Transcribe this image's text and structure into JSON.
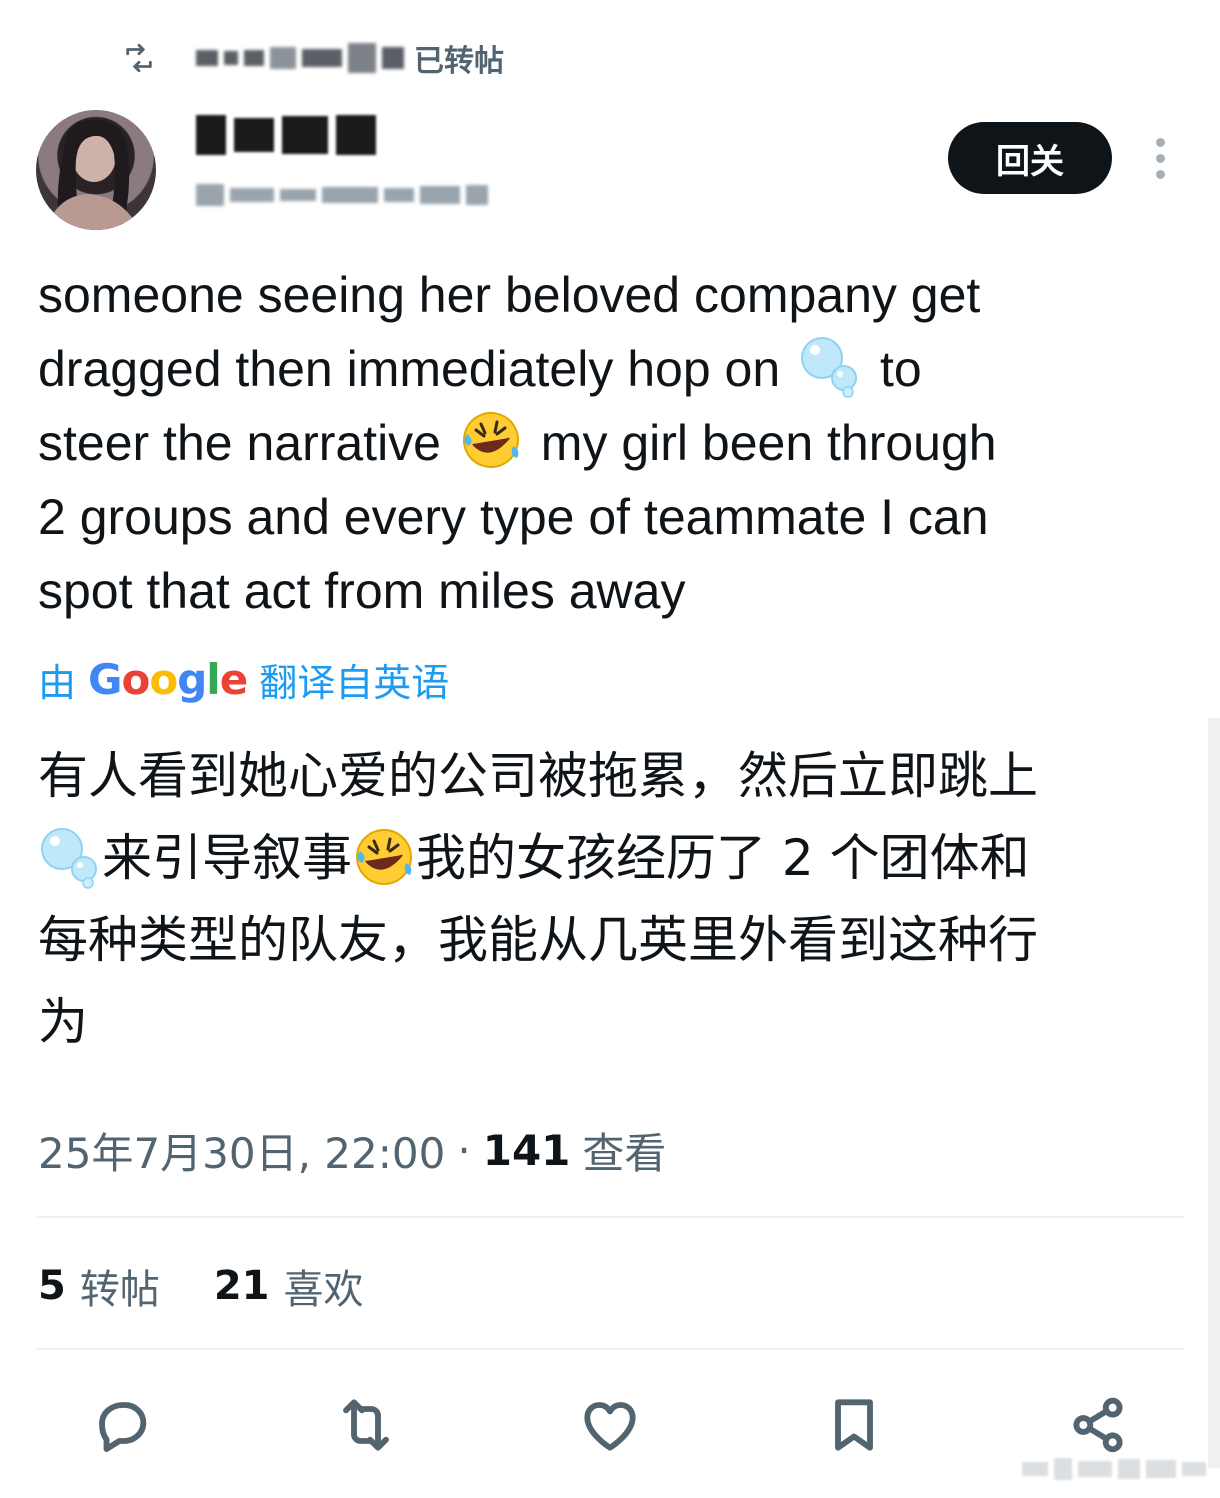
{
  "repost": {
    "suffix": "已转帖"
  },
  "author": {
    "follow_label": "回关"
  },
  "tweet": {
    "line1": "someone seeing her beloved company get",
    "line2a": "dragged then immediately hop on",
    "line2b": "to",
    "line3a": "steer the narrative",
    "line3b": "my girl been through",
    "line4": "2 groups and every type of teammate I can",
    "line5": "spot that act from miles away"
  },
  "translation": {
    "prefix": "由",
    "google": "Google",
    "suffix": "翻译自英语",
    "line1": "有人看到她心爱的公司被拖累，然后立即跳上",
    "line2a": "来引导叙事",
    "line2b": "我的女孩经历了 2 个团体和",
    "line3": "每种类型的队友，我能从几英里外看到这种行",
    "line4": "为"
  },
  "meta": {
    "datetime": "25年7月30日, 22:00",
    "separator": "·",
    "views_count": "141",
    "views_label": "查看"
  },
  "stats": {
    "reposts_count": "5",
    "reposts_label": "转帖",
    "likes_count": "21",
    "likes_label": "喜欢"
  },
  "actions": [
    {
      "icon": "reply-icon"
    },
    {
      "icon": "repost-icon"
    },
    {
      "icon": "like-icon"
    },
    {
      "icon": "bookmark-icon"
    },
    {
      "icon": "share-icon"
    }
  ],
  "colors": {
    "link_blue": "#1d9bf0",
    "text": "#0f1419",
    "muted": "#536471",
    "button_bg": "#0f1419"
  }
}
